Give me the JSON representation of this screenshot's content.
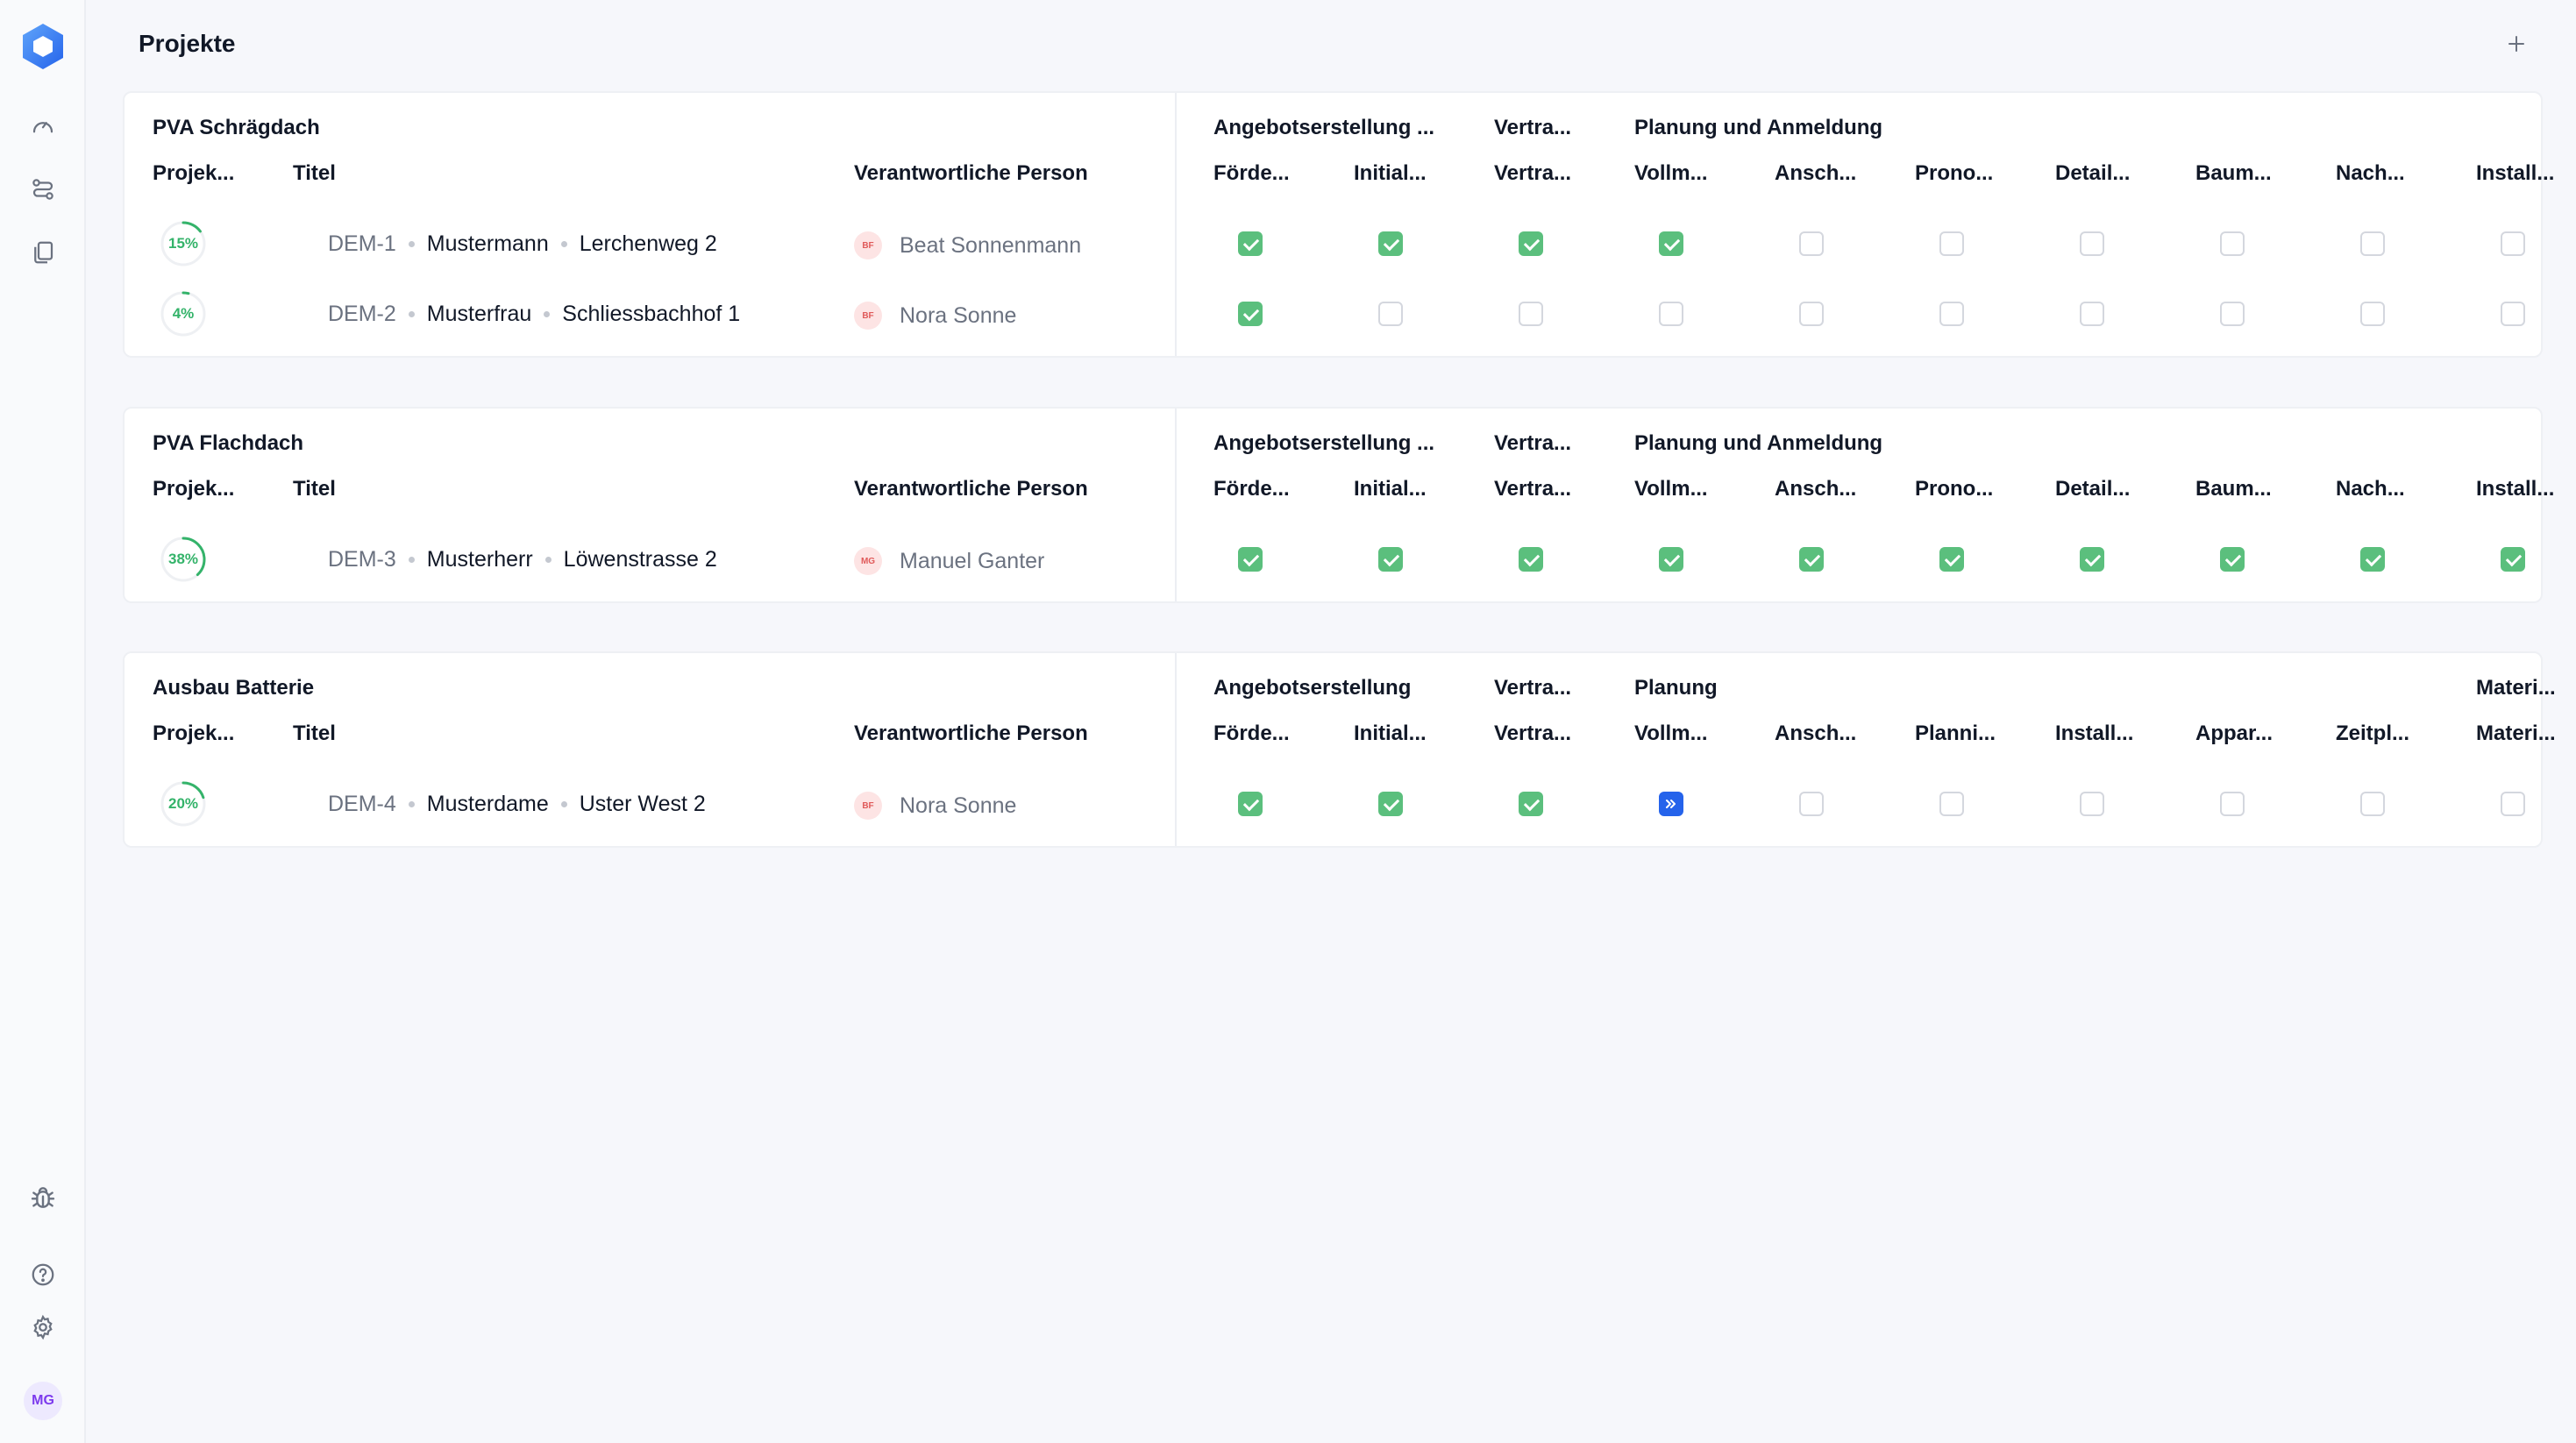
{
  "sidebar": {
    "avatar_initials": "MG",
    "icons": [
      "logo-icon",
      "dashboard-icon",
      "workflow-icon",
      "documents-icon",
      "bug-icon",
      "help-icon",
      "settings-icon"
    ]
  },
  "header": {
    "title": "Projekte",
    "add_symbol": "+"
  },
  "groups": [
    {
      "title": "PVA Schrägdach",
      "col_project": "Projek...",
      "col_title": "Titel",
      "col_person": "Verantwortliche Person",
      "stages": [
        {
          "label": "Angebotserstellung ...",
          "col": 0
        },
        {
          "label": "Vertra...",
          "col": 2
        },
        {
          "label": "Planung und Anmeldung",
          "col": 3
        }
      ],
      "steps": [
        "Förde...",
        "Initial...",
        "Vertra...",
        "Vollm...",
        "Ansch...",
        "Prono...",
        "Detail...",
        "Baum...",
        "Nach...",
        "Install..."
      ],
      "rows": [
        {
          "progress": 15,
          "progress_label": "15%",
          "id": "DEM-1",
          "name": "Mustermann",
          "address": "Lerchenweg 2",
          "person_initials": "BF",
          "person": "Beat Sonnenmann",
          "states": [
            "done",
            "done",
            "done",
            "done",
            "open",
            "open",
            "open",
            "open",
            "open",
            "open"
          ]
        },
        {
          "progress": 4,
          "progress_label": "4%",
          "id": "DEM-2",
          "name": "Musterfrau",
          "address": "Schliessbachhof 1",
          "person_initials": "BF",
          "person": "Nora Sonne",
          "states": [
            "done",
            "open",
            "open",
            "open",
            "open",
            "open",
            "open",
            "open",
            "open",
            "open"
          ]
        }
      ]
    },
    {
      "title": "PVA Flachdach",
      "col_project": "Projek...",
      "col_title": "Titel",
      "col_person": "Verantwortliche Person",
      "stages": [
        {
          "label": "Angebotserstellung ...",
          "col": 0
        },
        {
          "label": "Vertra...",
          "col": 2
        },
        {
          "label": "Planung und Anmeldung",
          "col": 3
        }
      ],
      "steps": [
        "Förde...",
        "Initial...",
        "Vertra...",
        "Vollm...",
        "Ansch...",
        "Prono...",
        "Detail...",
        "Baum...",
        "Nach...",
        "Install..."
      ],
      "rows": [
        {
          "progress": 38,
          "progress_label": "38%",
          "id": "DEM-3",
          "name": "Musterherr",
          "address": "Löwenstrasse 2",
          "person_initials": "MG",
          "person": "Manuel Ganter",
          "states": [
            "done",
            "done",
            "done",
            "done",
            "done",
            "done",
            "done",
            "done",
            "done",
            "done"
          ]
        }
      ]
    },
    {
      "title": "Ausbau Batterie",
      "col_project": "Projek...",
      "col_title": "Titel",
      "col_person": "Verantwortliche Person",
      "stages": [
        {
          "label": "Angebotserstellung",
          "col": 0
        },
        {
          "label": "Vertra...",
          "col": 2
        },
        {
          "label": "Planung",
          "col": 3
        },
        {
          "label": "Materi...",
          "col": 9
        }
      ],
      "steps": [
        "Förde...",
        "Initial...",
        "Vertra...",
        "Vollm...",
        "Ansch...",
        "Planni...",
        "Install...",
        "Appar...",
        "Zeitpl...",
        "Materi..."
      ],
      "rows": [
        {
          "progress": 20,
          "progress_label": "20%",
          "id": "DEM-4",
          "name": "Musterdame",
          "address": "Uster West 2",
          "person_initials": "BF",
          "person": "Nora Sonne",
          "states": [
            "done",
            "done",
            "done",
            "progress",
            "open",
            "open",
            "open",
            "open",
            "open",
            "open"
          ]
        }
      ]
    }
  ],
  "colors": {
    "done": "#5bbf7d",
    "progress": "#2563eb",
    "accent": "#3b82f6",
    "progress_ring": "#34b36a"
  }
}
